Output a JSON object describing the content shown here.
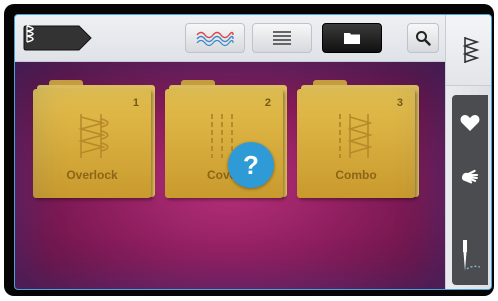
{
  "topbar": {
    "mode_icon": "stitch-category-icon",
    "tabs": [
      {
        "name": "stitches-view",
        "icon": "wave-stitch-icon",
        "active": false
      },
      {
        "name": "list-view",
        "icon": "list-icon",
        "active": false
      },
      {
        "name": "folder-view",
        "icon": "folder-icon",
        "active": true
      }
    ],
    "search_icon": "search-icon"
  },
  "folders": [
    {
      "number": "1",
      "label": "Overlock",
      "icon": "overlock-stitch-icon"
    },
    {
      "number": "2",
      "label": "Cover",
      "icon": "cover-stitch-icon"
    },
    {
      "number": "3",
      "label": "Combo",
      "icon": "combo-stitch-icon"
    }
  ],
  "help": {
    "label": "?"
  },
  "sidebar": {
    "top_icon": "stitch-menu-icon",
    "items": [
      {
        "name": "favorites",
        "icon": "heart-icon"
      },
      {
        "name": "personal",
        "icon": "hand-icon"
      },
      {
        "name": "needle",
        "icon": "needle-icon"
      }
    ]
  },
  "colors": {
    "accent": "#2f9bd6",
    "background_magenta": "#8a1d5c",
    "folder_gold": "#e4bf4e",
    "folder_text": "#8b6518"
  }
}
